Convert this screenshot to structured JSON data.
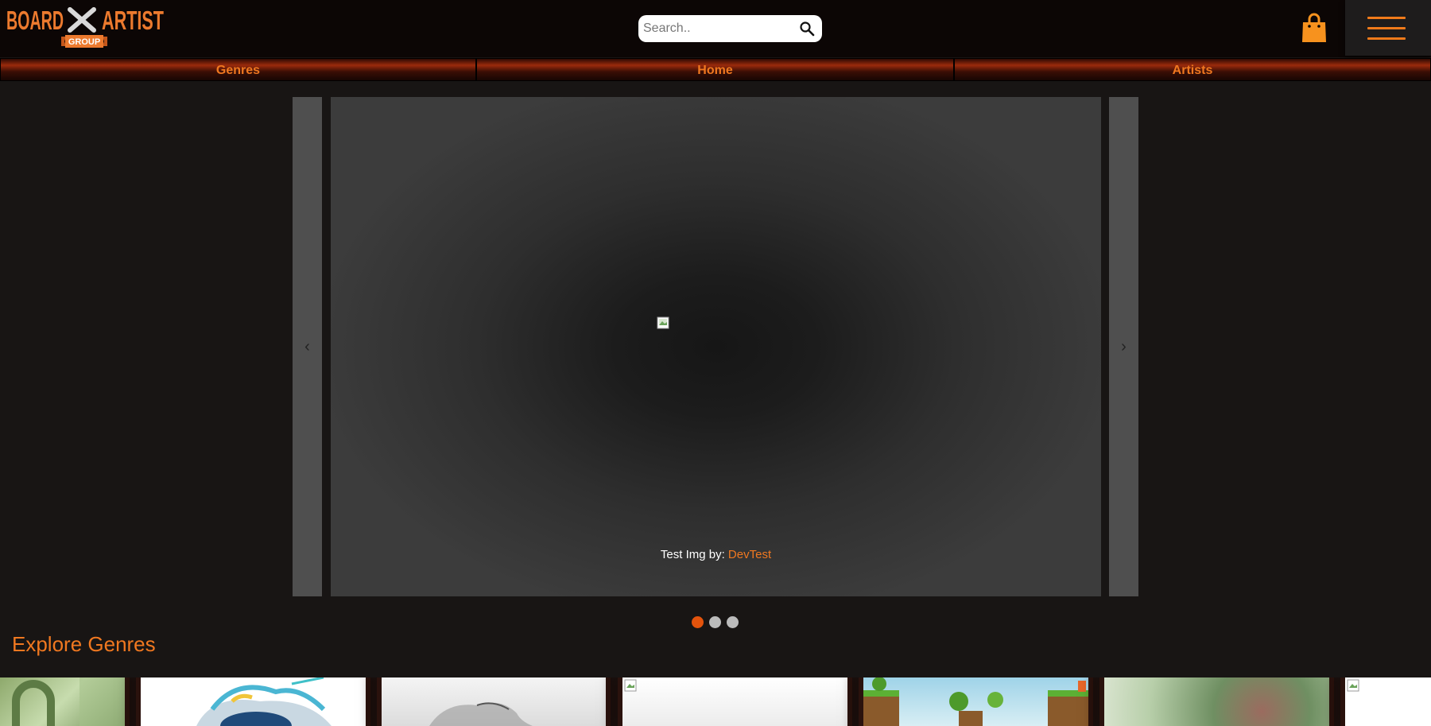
{
  "header": {
    "logo": {
      "board": "BOARD",
      "artist": "ARTIST",
      "group": "GROUP"
    },
    "search": {
      "placeholder": "Search.."
    }
  },
  "nav": {
    "items": [
      {
        "label": "Genres"
      },
      {
        "label": "Home"
      },
      {
        "label": "Artists"
      }
    ]
  },
  "carousel": {
    "prev_icon": "‹",
    "next_icon": "›",
    "caption_prefix": "Test Img by: ",
    "caption_artist": "DevTest",
    "slides_total": 3,
    "active_slide": 1
  },
  "explore": {
    "title": "Explore Genres"
  },
  "colors": {
    "accent": "#f07820",
    "active_dot": "#e3530c",
    "header_bg": "#0c0605",
    "page_bg": "#181514"
  }
}
